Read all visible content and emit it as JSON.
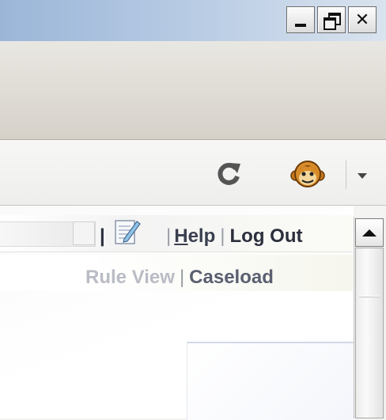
{
  "window": {
    "controls": [
      {
        "name": "minimize",
        "icon": "minimize-icon"
      },
      {
        "name": "restore",
        "icon": "restore-icon"
      },
      {
        "name": "close",
        "icon": "close-icon",
        "glyph": "✕"
      }
    ]
  },
  "toolbar": {
    "icons": [
      "reload-icon",
      "addon-monkey-icon",
      "dropdown-icon"
    ]
  },
  "links_top": {
    "sep1": "|",
    "edit_icon": "notepad-edit-icon",
    "sep2": "|",
    "help": "Help",
    "sep3": "|",
    "logout": "Log Out"
  },
  "links_second": {
    "prev_faded": "Rule View",
    "sep": "|",
    "caseload": "Caseload"
  }
}
